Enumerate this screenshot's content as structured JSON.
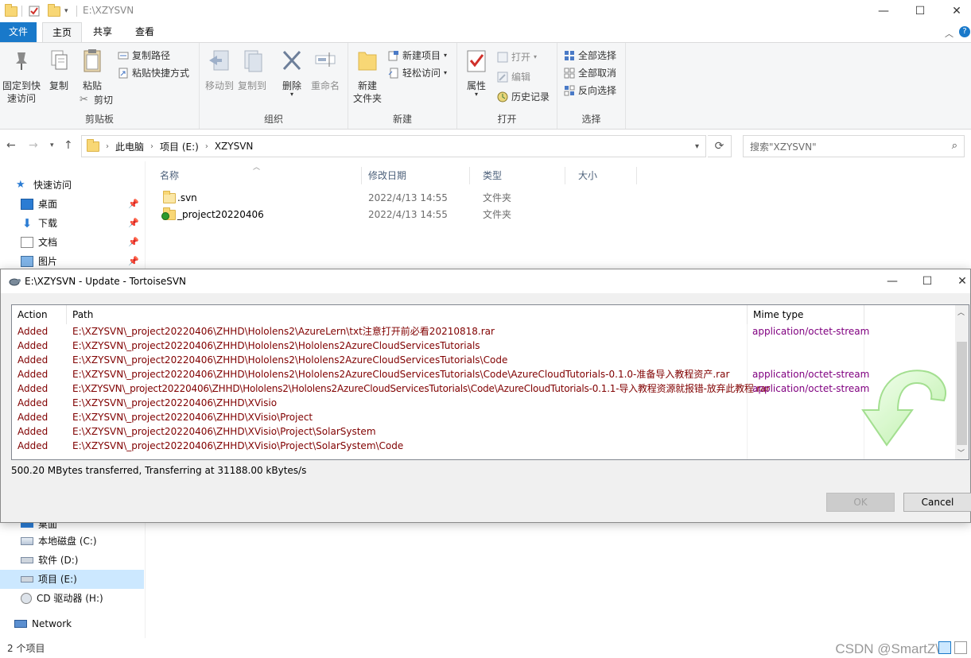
{
  "window": {
    "title": "E:\\XZYSVN",
    "minimize": "—",
    "maximize": "☐",
    "close": "✕"
  },
  "tabs": [
    {
      "label": "文件"
    },
    {
      "label": "主页"
    },
    {
      "label": "共享"
    },
    {
      "label": "查看"
    }
  ],
  "ribbon": {
    "clipboard": {
      "label": "剪贴板",
      "pin_line1": "固定到快",
      "pin_line2": "速访问",
      "copy": "复制",
      "paste": "粘贴",
      "copy_path": "复制路径",
      "paste_shortcut": "粘贴快捷方式",
      "cut": "剪切"
    },
    "organize": {
      "label": "组织",
      "move_to": "移动到",
      "copy_to": "复制到",
      "delete": "删除",
      "rename": "重命名"
    },
    "new": {
      "label": "新建",
      "new_folder_line1": "新建",
      "new_folder_line2": "文件夹",
      "new_item": "新建项目",
      "easy_access": "轻松访问"
    },
    "open": {
      "label": "打开",
      "properties": "属性",
      "open": "打开",
      "edit": "编辑",
      "history": "历史记录"
    },
    "select": {
      "label": "选择",
      "select_all": "全部选择",
      "select_none": "全部取消",
      "invert": "反向选择"
    }
  },
  "address": {
    "crumbs": [
      "此电脑",
      "项目 (E:)",
      "XZYSVN"
    ],
    "search_placeholder": "搜索\"XZYSVN\""
  },
  "sidebar": {
    "quick_access": "快速访问",
    "items": [
      {
        "label": "桌面"
      },
      {
        "label": "下载"
      },
      {
        "label": "文档"
      },
      {
        "label": "图片"
      }
    ],
    "desktop_partial": "桌面",
    "drives": [
      {
        "label": "本地磁盘 (C:)"
      },
      {
        "label": "软件 (D:)"
      },
      {
        "label": "项目 (E:)"
      },
      {
        "label": "CD 驱动器 (H:)"
      }
    ],
    "network": "Network"
  },
  "filelist": {
    "columns": [
      "名称",
      "修改日期",
      "类型",
      "大小"
    ],
    "rows": [
      {
        "name": ".svn",
        "date": "2022/4/13 14:55",
        "type": "文件夹"
      },
      {
        "name": "_project20220406",
        "date": "2022/4/13 14:55",
        "type": "文件夹"
      }
    ]
  },
  "status_bar": {
    "count": "2 个项目",
    "watermark": "CSDN @SmartZ\\"
  },
  "dialog": {
    "title": "E:\\XZYSVN - Update - TortoiseSVN",
    "columns": [
      "Action",
      "Path",
      "Mime type"
    ],
    "rows": [
      {
        "action": "Added",
        "path": "E:\\XZYSVN\\_project20220406\\ZHHD\\Hololens2\\AzureLern\\txt注意打开前必看20210818.rar",
        "mime": "application/octet-stream"
      },
      {
        "action": "Added",
        "path": "E:\\XZYSVN\\_project20220406\\ZHHD\\Hololens2\\Hololens2AzureCloudServicesTutorials",
        "mime": ""
      },
      {
        "action": "Added",
        "path": "E:\\XZYSVN\\_project20220406\\ZHHD\\Hololens2\\Hololens2AzureCloudServicesTutorials\\Code",
        "mime": ""
      },
      {
        "action": "Added",
        "path": "E:\\XZYSVN\\_project20220406\\ZHHD\\Hololens2\\Hololens2AzureCloudServicesTutorials\\Code\\AzureCloudTutorials-0.1.0-准备导入教程资产.rar",
        "mime": "application/octet-stream"
      },
      {
        "action": "Added",
        "path": "E:\\XZYSVN\\_project20220406\\ZHHD\\Hololens2\\Hololens2AzureCloudServicesTutorials\\Code\\AzureCloudTutorials-0.1.1-导入教程资源就报错-放弃此教程.rar",
        "mime": "application/octet-stream"
      },
      {
        "action": "Added",
        "path": "E:\\XZYSVN\\_project20220406\\ZHHD\\XVisio",
        "mime": ""
      },
      {
        "action": "Added",
        "path": "E:\\XZYSVN\\_project20220406\\ZHHD\\XVisio\\Project",
        "mime": ""
      },
      {
        "action": "Added",
        "path": "E:\\XZYSVN\\_project20220406\\ZHHD\\XVisio\\Project\\SolarSystem",
        "mime": ""
      },
      {
        "action": "Added",
        "path": "E:\\XZYSVN\\_project20220406\\ZHHD\\XVisio\\Project\\SolarSystem\\Code",
        "mime": ""
      }
    ],
    "status": "500.20 MBytes transferred, Transferring at 31188.00 kBytes/s",
    "ok": "OK",
    "cancel": "Cancel"
  },
  "colors": {
    "accent": "#1979ca",
    "added": "#800000",
    "mime": "#800080",
    "selection": "#cce8ff"
  }
}
